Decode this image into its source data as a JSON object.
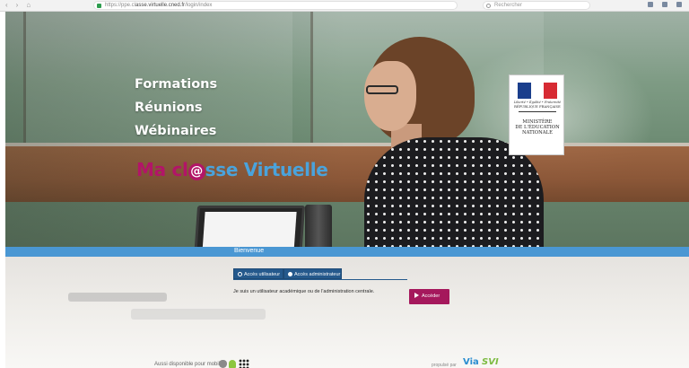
{
  "browser": {
    "url_prefix": "https://ppe.cl",
    "url_main": "asse.virtuelle.cned.fr",
    "url_suffix": "/login/index",
    "search_placeholder": "Rechercher"
  },
  "hero": {
    "lines": [
      "Formations",
      "Réunions",
      "Wébinaires"
    ],
    "brand": {
      "part1": "Ma",
      "part2": "cl",
      "at": "@",
      "part3": "sse Virtuelle"
    },
    "ministry": {
      "motto": "Liberté • Égalité • Fraternité",
      "republic": "RÉPUBLIQUE FRANÇAISE",
      "name_line1": "MINISTÈRE",
      "name_line2": "DE L'ÉDUCATION",
      "name_line3": "NATIONALE"
    }
  },
  "login": {
    "welcome": "Bienvenue",
    "tab_user": "Accès utilisateur",
    "tab_admin": "Accès administrateur",
    "description": "Je suis un utilisateur académique ou de l'administration centrale.",
    "submit": "Accéder"
  },
  "footer": {
    "mobile_text": "Aussi disponible pour mobile",
    "platform_icons": [
      "apple-icon",
      "android-icon",
      "blackberry-icon"
    ],
    "provider_prefix": "propulsé par",
    "provider_logo_1": "Via",
    "provider_logo_2": "SVI"
  },
  "colors": {
    "brand_magenta": "#b21568",
    "brand_blue": "#4aa3dc",
    "strip_blue": "#4a97d3",
    "tab_navy": "#25598c",
    "button_magenta": "#a5185c"
  }
}
